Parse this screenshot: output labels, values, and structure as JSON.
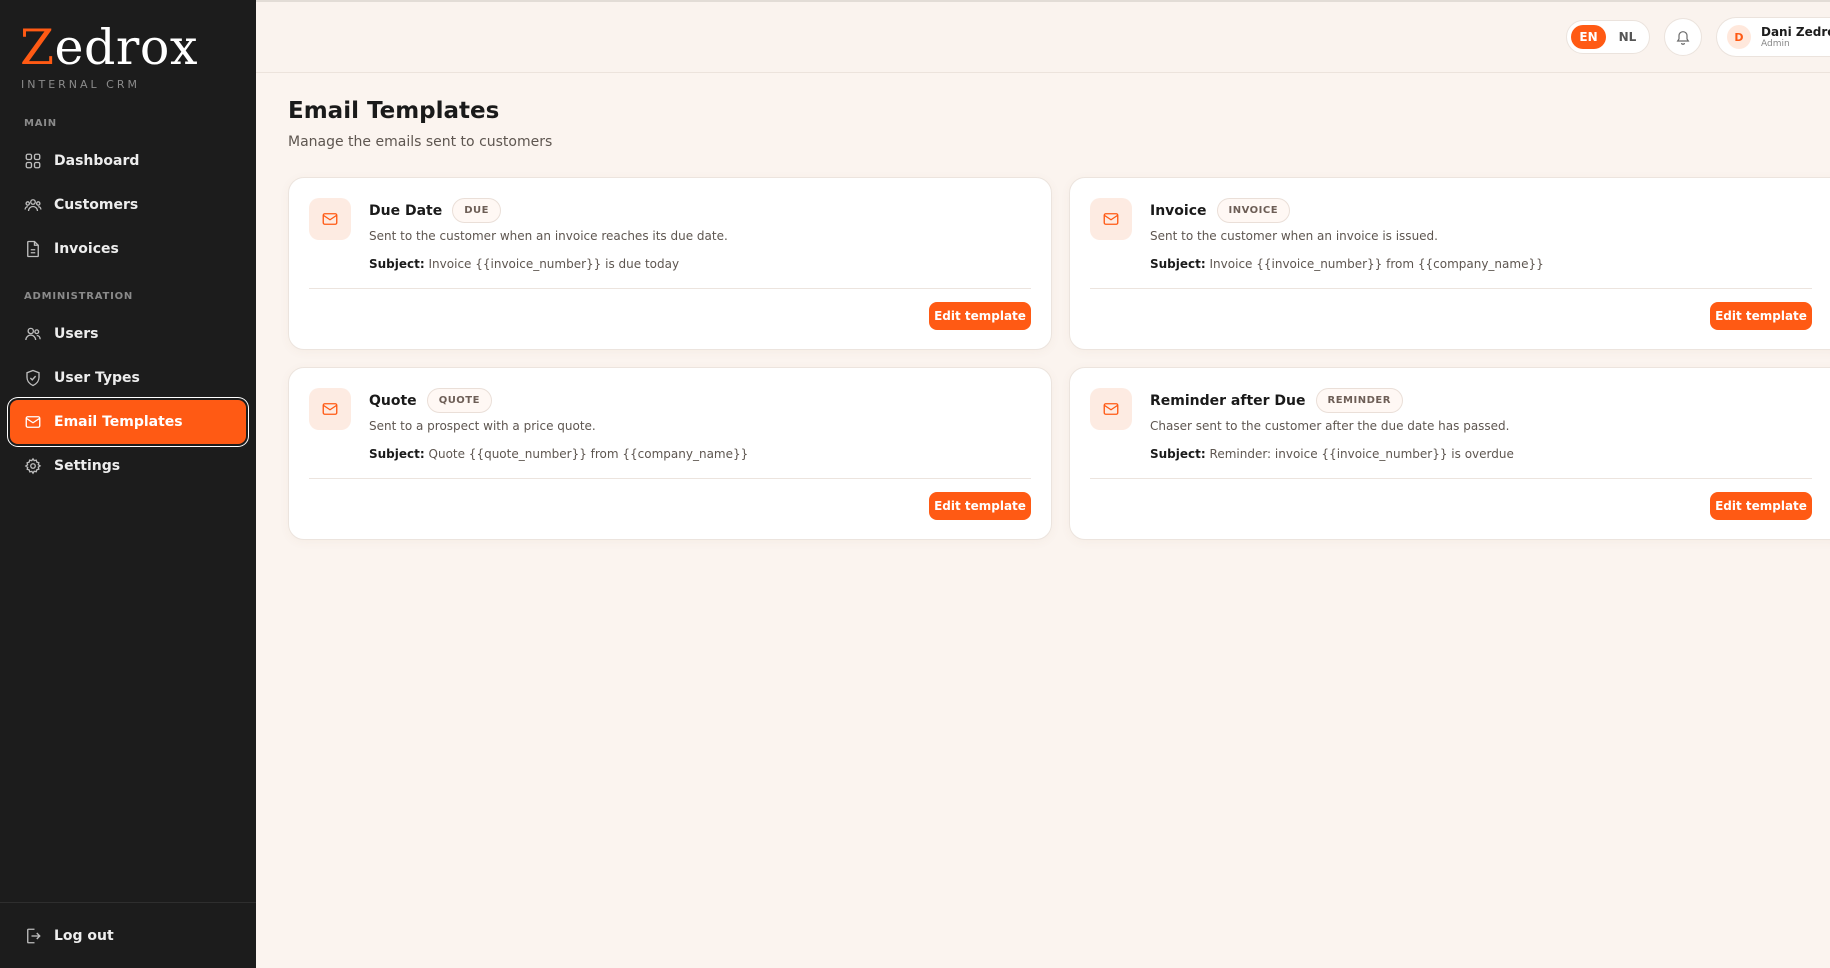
{
  "brand": {
    "logo_first": "Z",
    "logo_rest": "edrox",
    "subtitle": "INTERNAL CRM"
  },
  "sidebar": {
    "main_label": "MAIN",
    "admin_label": "ADMINISTRATION",
    "main_items": [
      {
        "label": "Dashboard",
        "icon": "grid-icon"
      },
      {
        "label": "Customers",
        "icon": "users-icon"
      },
      {
        "label": "Invoices",
        "icon": "document-icon"
      }
    ],
    "admin_items": [
      {
        "label": "Users",
        "icon": "users-icon"
      },
      {
        "label": "User Types",
        "icon": "shield-icon"
      },
      {
        "label": "Email Templates",
        "icon": "mail-icon",
        "active": true
      },
      {
        "label": "Settings",
        "icon": "gear-icon"
      }
    ],
    "logout_label": "Log out"
  },
  "topbar": {
    "lang_en": "EN",
    "lang_nl": "NL",
    "active_lang": "EN",
    "user_initial": "D",
    "user_name": "Dani Zedrox",
    "user_role": "Admin"
  },
  "page": {
    "title": "Email Templates",
    "subtitle": "Manage the emails sent to customers"
  },
  "subject_label": "Subject:",
  "edit_label": "Edit template",
  "templates": [
    {
      "title": "Due Date",
      "badge": "DUE",
      "description": "Sent to the customer when an invoice reaches its due date.",
      "subject": "Invoice {{invoice_number}} is due today"
    },
    {
      "title": "Invoice",
      "badge": "INVOICE",
      "description": "Sent to the customer when an invoice is issued.",
      "subject": "Invoice {{invoice_number}} from {{company_name}}"
    },
    {
      "title": "Quote",
      "badge": "QUOTE",
      "description": "Sent to a prospect with a price quote.",
      "subject": "Quote {{quote_number}} from {{company_name}}"
    },
    {
      "title": "Reminder after Due",
      "badge": "REMINDER",
      "description": "Chaser sent to the customer after the due date has passed.",
      "subject": "Reminder: invoice {{invoice_number}} is overdue"
    }
  ],
  "colors": {
    "accent": "#ff5a14",
    "sidebar_bg": "#1c1c1c",
    "page_bg": "#fbf4ef"
  }
}
